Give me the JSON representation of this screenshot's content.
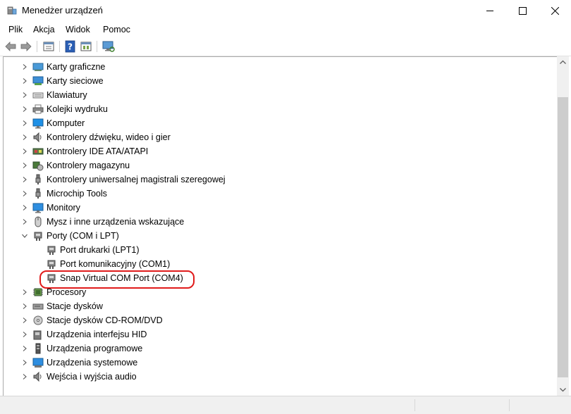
{
  "window": {
    "title": "Menedżer urządzeń",
    "controls": [
      "minimize-icon",
      "maximize-icon",
      "close-icon"
    ]
  },
  "menu": {
    "items": [
      "Plik",
      "Akcja",
      "Widok",
      "Pomoc"
    ]
  },
  "toolbar": {
    "buttons": [
      "back-arrow-icon",
      "forward-arrow-icon",
      "properties-icon",
      "help-icon",
      "device-view-icon",
      "monitor-scan-icon"
    ]
  },
  "tree": {
    "items": [
      {
        "label": "Karty graficzne",
        "icon": "display-adapter-icon",
        "expanded": false
      },
      {
        "label": "Karty sieciowe",
        "icon": "network-adapter-icon",
        "expanded": false
      },
      {
        "label": "Klawiatury",
        "icon": "keyboard-icon",
        "expanded": false
      },
      {
        "label": "Kolejki wydruku",
        "icon": "printer-icon",
        "expanded": false
      },
      {
        "label": "Komputer",
        "icon": "computer-icon",
        "expanded": false
      },
      {
        "label": "Kontrolery dźwięku, wideo i gier",
        "icon": "speaker-icon",
        "expanded": false
      },
      {
        "label": "Kontrolery IDE ATA/ATAPI",
        "icon": "ide-controller-icon",
        "expanded": false
      },
      {
        "label": "Kontrolery magazynu",
        "icon": "storage-controller-icon",
        "expanded": false
      },
      {
        "label": "Kontrolery uniwersalnej magistrali szeregowej",
        "icon": "usb-icon",
        "expanded": false
      },
      {
        "label": "Microchip Tools",
        "icon": "usb-icon",
        "expanded": false
      },
      {
        "label": "Monitory",
        "icon": "monitor-icon",
        "expanded": false
      },
      {
        "label": "Mysz i inne urządzenia wskazujące",
        "icon": "mouse-icon",
        "expanded": false
      },
      {
        "label": "Porty (COM i LPT)",
        "icon": "port-icon",
        "expanded": true
      },
      {
        "label": "Port drukarki (LPT1)",
        "icon": "port-icon",
        "child": true
      },
      {
        "label": "Port komunikacyjny (COM1)",
        "icon": "port-icon",
        "child": true
      },
      {
        "label": "Snap Virtual COM Port (COM4)",
        "icon": "port-icon",
        "child": true,
        "highlighted": true
      },
      {
        "label": "Procesory",
        "icon": "processor-icon",
        "expanded": false
      },
      {
        "label": "Stacje dysków",
        "icon": "disk-drive-icon",
        "expanded": false
      },
      {
        "label": "Stacje dysków CD-ROM/DVD",
        "icon": "cdrom-icon",
        "expanded": false
      },
      {
        "label": "Urządzenia interfejsu HID",
        "icon": "hid-icon",
        "expanded": false
      },
      {
        "label": "Urządzenia programowe",
        "icon": "software-device-icon",
        "expanded": false
      },
      {
        "label": "Urządzenia systemowe",
        "icon": "system-device-icon",
        "expanded": false
      },
      {
        "label": "Wejścia i wyjścia audio",
        "icon": "speaker-icon",
        "expanded": false
      }
    ]
  },
  "colors": {
    "highlight_border": "#e01b1b",
    "accent_blue": "#1e78d7"
  }
}
